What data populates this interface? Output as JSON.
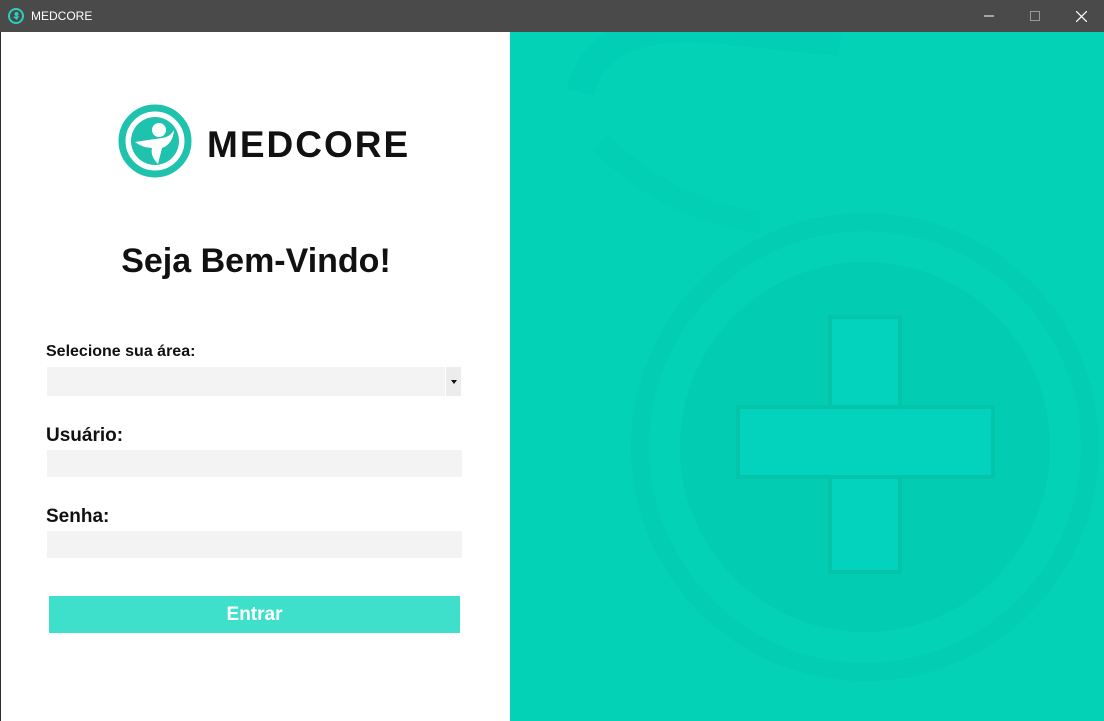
{
  "window": {
    "title": "MEDCORE",
    "minimize_glyph": "—",
    "maximize_glyph": "☐",
    "close_glyph": "✕"
  },
  "brand": {
    "name": "MEDCORE",
    "icon": "medcore-logo-icon",
    "color": "#1fc2ad"
  },
  "login": {
    "welcome": "Seja Bem-Vindo!",
    "area_label": "Selecione sua área:",
    "area_value": "",
    "user_label": "Usuário:",
    "user_value": "",
    "password_label": "Senha:",
    "password_value": "",
    "submit_label": "Entrar"
  },
  "colors": {
    "accent": "#03d2b7",
    "button": "#3fe0cb",
    "titlebar": "#4a4a4a"
  },
  "hero": {
    "icon": "medical-cross-stethoscope-icon"
  }
}
